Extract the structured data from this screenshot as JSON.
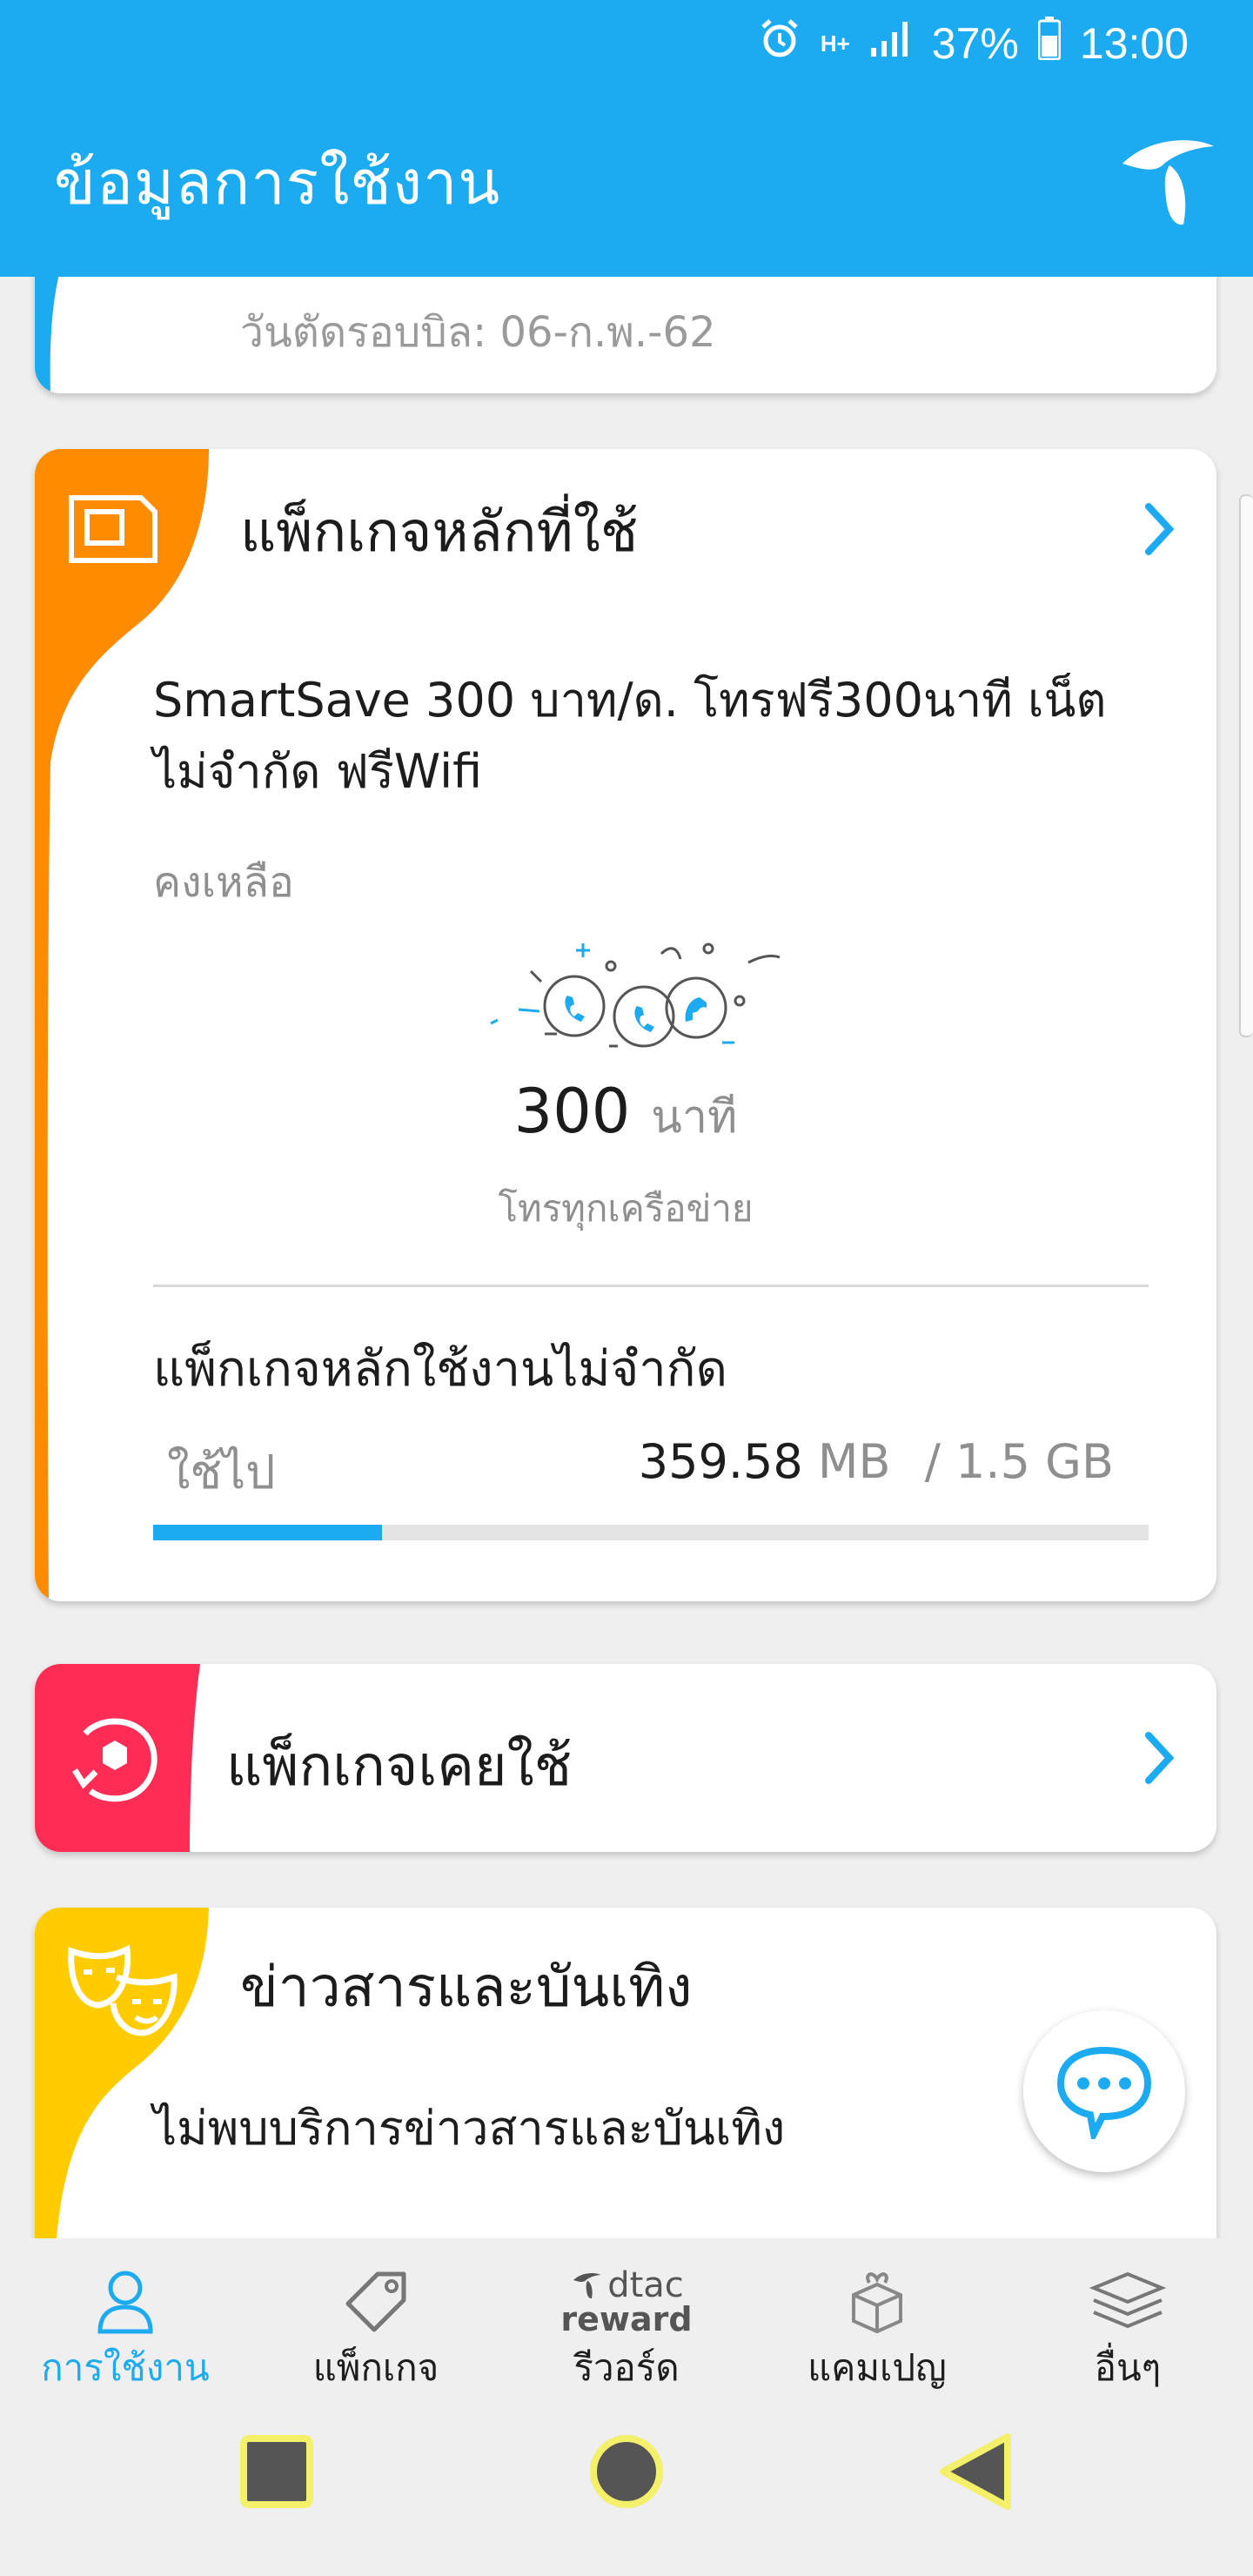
{
  "status": {
    "signal": "H+",
    "battery": "37%",
    "time": "13:00"
  },
  "header": {
    "title": "ข้อมูลการใช้งาน"
  },
  "bill_card": {
    "cutoff_text": "วันตัดรอบบิล: 06-ก.พ.-62"
  },
  "main_package": {
    "title": "แพ็กเกจหลักที่ใช้",
    "name": "SmartSave 300 บาท/ด. โทรฟรี300นาที เน็ต ไม่จำกัด ฟรีWifi",
    "remaining_label": "คงเหลือ",
    "minutes_value": "300",
    "minutes_unit": "นาที",
    "network_label": "โทรทุกเครือข่าย",
    "unlimited_title": "แพ็กเกจหลักใช้งานไม่จำกัด",
    "used_label": "ใช้ไป",
    "used_amount": "359.58",
    "used_unit": "MB",
    "quota": "/ 1.5 GB",
    "used_fraction": 0.23
  },
  "past_package": {
    "title": "แพ็กเกจเคยใช้"
  },
  "news": {
    "title": "ข่าวสารและบันเทิง",
    "empty_text": "ไม่พบบริการข่าวสารและบันเทิง"
  },
  "bottom_nav": {
    "items": [
      {
        "label": "การใช้งาน",
        "icon": "user-icon",
        "active": true
      },
      {
        "label": "แพ็กเกจ",
        "icon": "tag-icon",
        "active": false
      },
      {
        "label": "รีวอร์ด",
        "icon": "dtac-reward-logo",
        "logo_line1": "dtac",
        "logo_line2": "reward",
        "active": false
      },
      {
        "label": "แคมเปญ",
        "icon": "gift-box-icon",
        "active": false
      },
      {
        "label": "อื่นๆ",
        "icon": "stack-icon",
        "active": false
      }
    ]
  },
  "colors": {
    "primary": "#1caaf1",
    "orange": "#ff8c00",
    "pink": "#ff2d55",
    "yellow": "#ffcc00"
  }
}
